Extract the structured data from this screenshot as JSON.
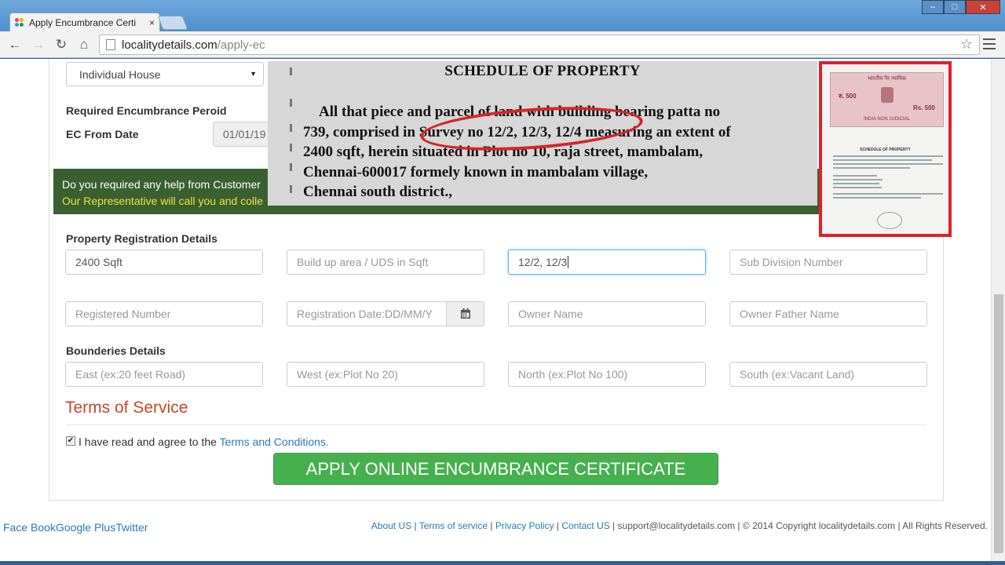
{
  "browser": {
    "tab_title": "Apply Encumbrance Certi",
    "tab_close": "×",
    "url_host": "localitydetails.com",
    "url_path": "/apply-ec",
    "window_buttons": {
      "minimize": "–",
      "maximize": "□",
      "close": "✕"
    }
  },
  "form": {
    "property_type": "Individual House",
    "required_period_label": "Required Encumbrance Peroid",
    "ec_from_label": "EC From Date",
    "ec_from_value": "01/01/19",
    "help": {
      "line1": "Do you required any help from Customer",
      "line2": "Our Representative will call you and colle"
    },
    "registration_title": "Property Registration Details",
    "area_value": "2400 Sqft",
    "buildup_placeholder": "Build up area / UDS in Sqft",
    "survey_value": "12/2, 12/3",
    "subdivision_placeholder": "Sub Division Number",
    "registered_number_placeholder": "Registered Number",
    "registration_date_placeholder": "Registration Date:DD/MM/Y",
    "owner_name_placeholder": "Owner Name",
    "owner_father_placeholder": "Owner Father Name",
    "boundaries_title": "Bounderies Details",
    "east_placeholder": "East (ex:20 feet Road)",
    "west_placeholder": "West (ex:Plot No 20)",
    "north_placeholder": "North (ex:Plot No 100)",
    "south_placeholder": "South (ex:Vacant Land)",
    "terms_title": "Terms of Service",
    "agree_text": "I have read and agree to the",
    "agree_link": "Terms and Conditions.",
    "agree_checked": true,
    "apply_button": "APPLY ONLINE ENCUMBRANCE CERTIFICATE"
  },
  "footer": {
    "social": [
      "Face Book",
      "Google Plus",
      "Twitter"
    ],
    "links": [
      "About US",
      "Terms of service",
      "Privacy Policy",
      "Contact US"
    ],
    "email": "support@localitydetails.com",
    "copyright": "© 2014 Copyright localitydetails.com | All Rights Reserved."
  },
  "overlay": {
    "heading": "SCHEDULE  OF PROPERTY",
    "lines": [
      "All that piece and parcel of land with building bearing patta no",
      "739, comprised in Survey no 12/2, 12/3, 12/4 measuring an extent of",
      "2400 sqft, herein situated in Plot no 10, raja street, mambalam,",
      "Chennai-600017 formely known in mambalam village,",
      "Chennai south district.,"
    ],
    "highlight_color": "#d8232a"
  },
  "document_thumbnail": {
    "stamp_top": "भारतीय गैर न्यायिक",
    "stamp_value_left": "रु. 500",
    "stamp_value_right": "Rs. 500",
    "stamp_bottom": "INDIA NON JUDICIAL",
    "schedule_heading": "SCHEDULE OF PROPERTY",
    "border_color": "#e0202a"
  },
  "colors": {
    "accent_link": "#2a7ab0",
    "button_green": "#46b04f",
    "terms_red": "#c9452a",
    "help_bar": "#3a6030"
  }
}
